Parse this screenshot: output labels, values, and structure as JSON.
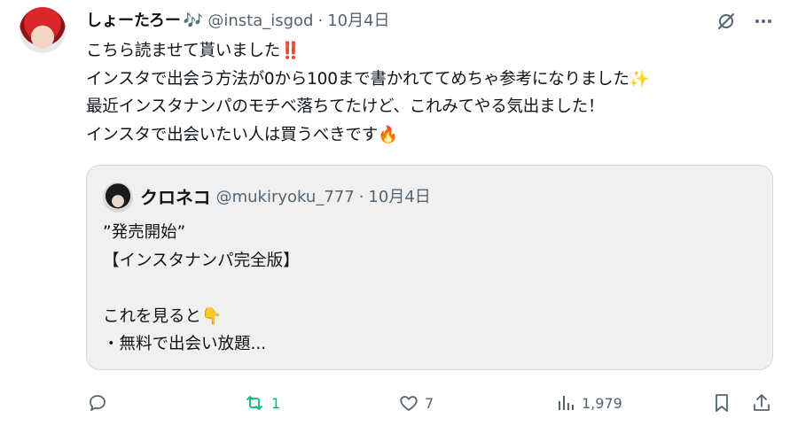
{
  "post": {
    "display_name": "しょーたろー",
    "name_emoji": "🎶",
    "handle": "@insta_isgod",
    "dot": "·",
    "date": "10月4日",
    "lines": [
      "こちら読ませて貰いました‼️",
      "インスタで出会う方法が0から100まで書かれててめちゃ参考になりました✨",
      "最近インスタナンパのモチベ落ちてたけど、これみてやる気出ました！",
      "インスタで出会いたい人は買うべきです🔥"
    ]
  },
  "quote": {
    "display_name": "クロネコ",
    "handle": "@mukiryoku_777",
    "dot": "·",
    "date": "10月4日",
    "lines": [
      "”発売開始”",
      "【インスタナンパ完全版】",
      "",
      "これを見ると👇",
      "・無料で出会い放題..."
    ]
  },
  "actions": {
    "reply_count": "",
    "repost_count": "1",
    "like_count": "7",
    "views_count": "1,979"
  },
  "icons": {
    "grok": "grok-slash-icon",
    "more": "more-dots-icon",
    "reply": "reply-icon",
    "repost": "repost-icon",
    "like": "heart-icon",
    "views": "views-bars-icon",
    "bookmark": "bookmark-icon",
    "share": "share-icon"
  },
  "colors": {
    "text": "#0f1419",
    "muted": "#536471",
    "repost_active": "#00ba7c",
    "quote_bg": "#f0f0f0",
    "border": "#cfd9de"
  }
}
